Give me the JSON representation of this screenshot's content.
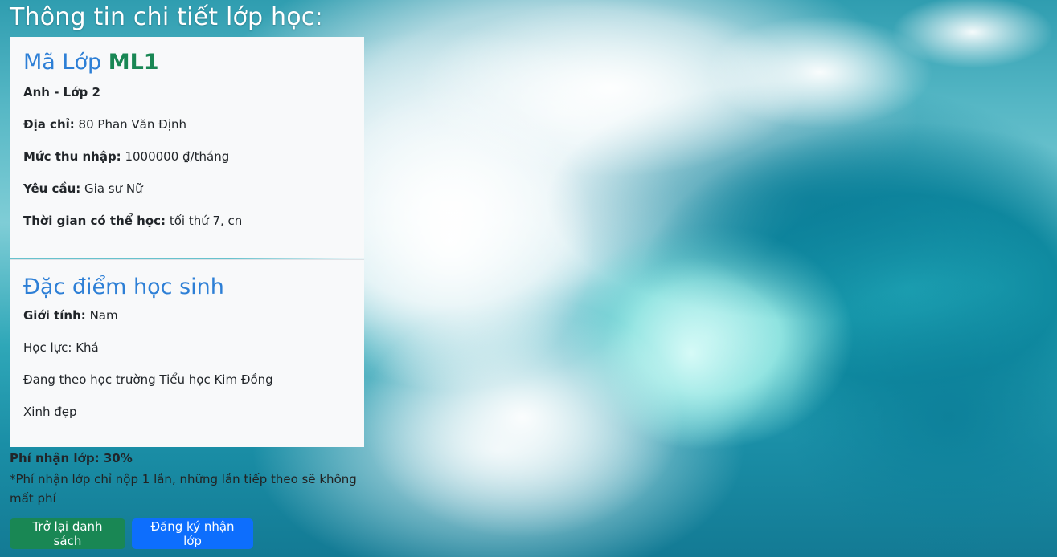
{
  "page": {
    "title": "Thông tin chi tiết lớp học:"
  },
  "class_info": {
    "code_label": "Mã Lớp",
    "code_value": "ML1",
    "subject_grade": "Anh - Lớp 2",
    "address_label": "Địa chỉ:",
    "address_value": "80 Phan Văn Định",
    "income_label": "Mức thu nhập:",
    "income_value": "1000000 ₫/tháng",
    "requirement_label": "Yêu cầu:",
    "requirement_value": "Gia sư Nữ",
    "schedule_label": "Thời gian có thể học:",
    "schedule_value": "tối thứ 7, cn"
  },
  "student_info": {
    "heading": "Đặc điểm học sinh",
    "gender_label": "Giới tính:",
    "gender_value": "Nam",
    "academic": "Học lực: Khá",
    "school": "Đang theo học trường Tiểu học Kim Đồng",
    "note": "Xinh đẹp"
  },
  "fee": {
    "label": "Phí nhận lớp: 30%",
    "note": "*Phí nhận lớp chỉ nộp 1 lần, những lần tiếp theo sẽ không mất phí"
  },
  "buttons": {
    "back_label": "Trở lại danh sách",
    "register_label": "Đăng ký nhận lớp"
  },
  "colors": {
    "heading_blue": "#2d7fd6",
    "code_green": "#198754",
    "back_button": "#198754",
    "register_button": "#0d6efd"
  }
}
